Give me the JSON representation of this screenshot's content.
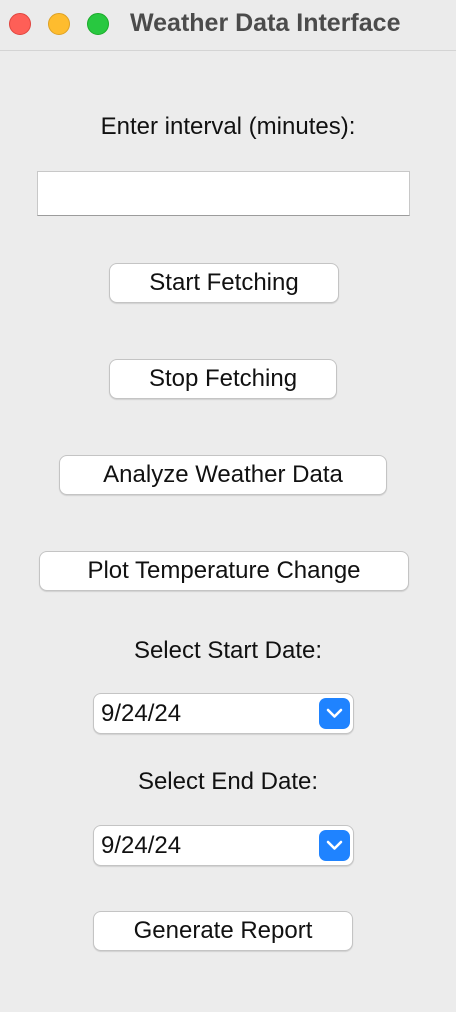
{
  "window": {
    "title": "Weather Data Interface"
  },
  "interval": {
    "label": "Enter interval (minutes):",
    "value": ""
  },
  "buttons": {
    "start_fetching": "Start Fetching",
    "stop_fetching": "Stop Fetching",
    "analyze": "Analyze Weather Data",
    "plot": "Plot Temperature Change",
    "generate_report": "Generate Report"
  },
  "start_date": {
    "label": "Select Start Date:",
    "value": "9/24/24"
  },
  "end_date": {
    "label": "Select End Date:",
    "value": "9/24/24"
  },
  "colors": {
    "close": "#fe5f57",
    "minimize": "#febc2e",
    "maximize": "#28c840",
    "dropdown_accent": "#1f83ff"
  }
}
